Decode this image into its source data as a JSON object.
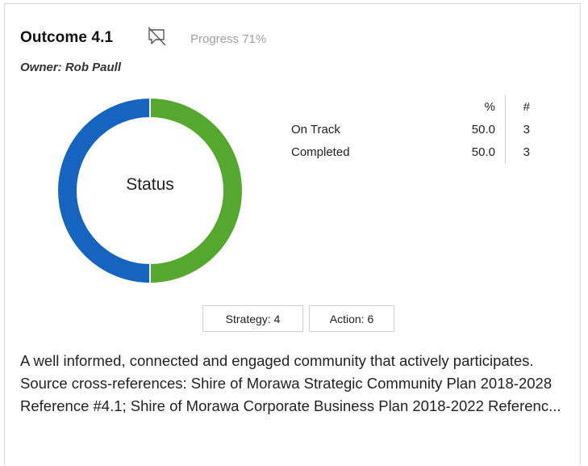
{
  "card": {
    "title": "Outcome 4.1",
    "progress_text": "Progress 71%",
    "progress_value": 71,
    "owner": "Owner: Rob Paull",
    "comment_icon": "speech-bubble-slash-icon",
    "status_chart": {
      "center_label": "Status",
      "colors": {
        "on_track": "#55a82e",
        "completed": "#1565c0"
      }
    },
    "stats_table": {
      "headers": {
        "label": "",
        "percent": "%",
        "count": "#"
      },
      "rows": [
        {
          "label": "On Track",
          "percent": "50.0",
          "count": "3"
        },
        {
          "label": "Completed",
          "percent": "50.0",
          "count": "3"
        }
      ]
    },
    "chips": {
      "strategy": "Strategy: 4",
      "action": "Action: 6"
    },
    "description": "A well informed, connected and engaged community that actively participates. Source cross-references: Shire of Morawa Strategic Community Plan 2018-2028 Reference #4.1; Shire of Morawa Corporate Business Plan 2018-2022 Referenc..."
  },
  "chart_data": {
    "type": "pie",
    "title": "Status",
    "categories": [
      "On Track",
      "Completed"
    ],
    "values": [
      50.0,
      50.0
    ],
    "counts": [
      3,
      3
    ],
    "colors": [
      "#55a82e",
      "#1565c0"
    ]
  }
}
